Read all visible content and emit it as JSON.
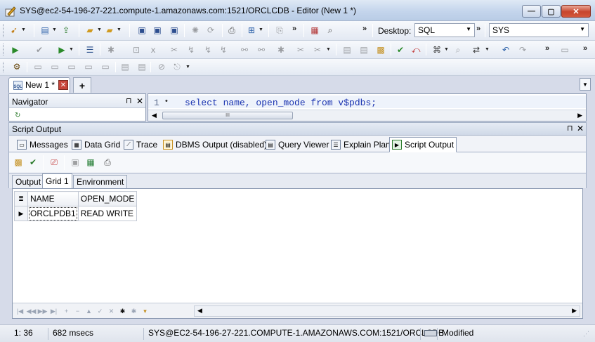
{
  "window": {
    "title": "SYS@ec2-54-196-27-221.compute-1.amazonaws.com:1521/ORCLCDB - Editor (New 1 *)",
    "minimize_glyph": "—",
    "maximize_glyph": "▢",
    "close_glyph": "✕"
  },
  "toolbar": {
    "desktop_label": "Desktop:",
    "desktop_value": "SQL",
    "connection_value": "SYS"
  },
  "doc_tabs": {
    "active_tab_label": "New 1 *",
    "add_glyph": "+",
    "close_glyph": "✕",
    "list_glyph": "▼"
  },
  "navigator": {
    "title": "Navigator",
    "pin_glyph": "⊓",
    "close_glyph": "✕",
    "refresh_glyph": "↻"
  },
  "editor": {
    "line_number": "1",
    "line_marker": "•",
    "code": "select name, open_mode from v$pdbs;",
    "thumb_glyph": "III"
  },
  "script_output": {
    "title": "Script Output",
    "pin_glyph": "⊓",
    "close_glyph": "✕",
    "tabs": [
      {
        "label": "Messages",
        "icon": "messages-icon"
      },
      {
        "label": "Data Grid",
        "icon": "data-grid-icon"
      },
      {
        "label": "Trace",
        "icon": "trace-icon"
      },
      {
        "label": "DBMS Output (disabled)",
        "icon": "dbms-output-icon"
      },
      {
        "label": "Query Viewer",
        "icon": "query-viewer-icon"
      },
      {
        "label": "Explain Plan",
        "icon": "explain-plan-icon"
      },
      {
        "label": "Script Output",
        "icon": "script-output-icon",
        "active": true
      }
    ],
    "sub_tabs": [
      "Output",
      "Grid 1",
      "Environment"
    ],
    "active_sub_tab": "Grid 1"
  },
  "grid": {
    "columns": [
      "NAME",
      "OPEN_MODE"
    ],
    "rows": [
      [
        "ORCLPDB1",
        "READ WRITE"
      ]
    ],
    "row_marker": "▶",
    "header_marker": "≣"
  },
  "grid_nav": [
    "|◀",
    "◀◀",
    "▶▶",
    "▶|",
    "+",
    "−",
    "▲",
    "✓",
    "✕",
    "✱",
    "✱",
    "▾"
  ],
  "status": {
    "position": "1: 36",
    "elapsed": "682 msecs",
    "connection": "SYS@EC2-54-196-27-221.COMPUTE-1.AMAZONAWS.COM:1521/ORCLCDB",
    "mode": "Modified",
    "grip_glyph": "⋰"
  },
  "colors": {
    "keyword": "#1a33b0",
    "title_gradient_top": "#dfe9f5",
    "close_button": "#c8452c"
  }
}
